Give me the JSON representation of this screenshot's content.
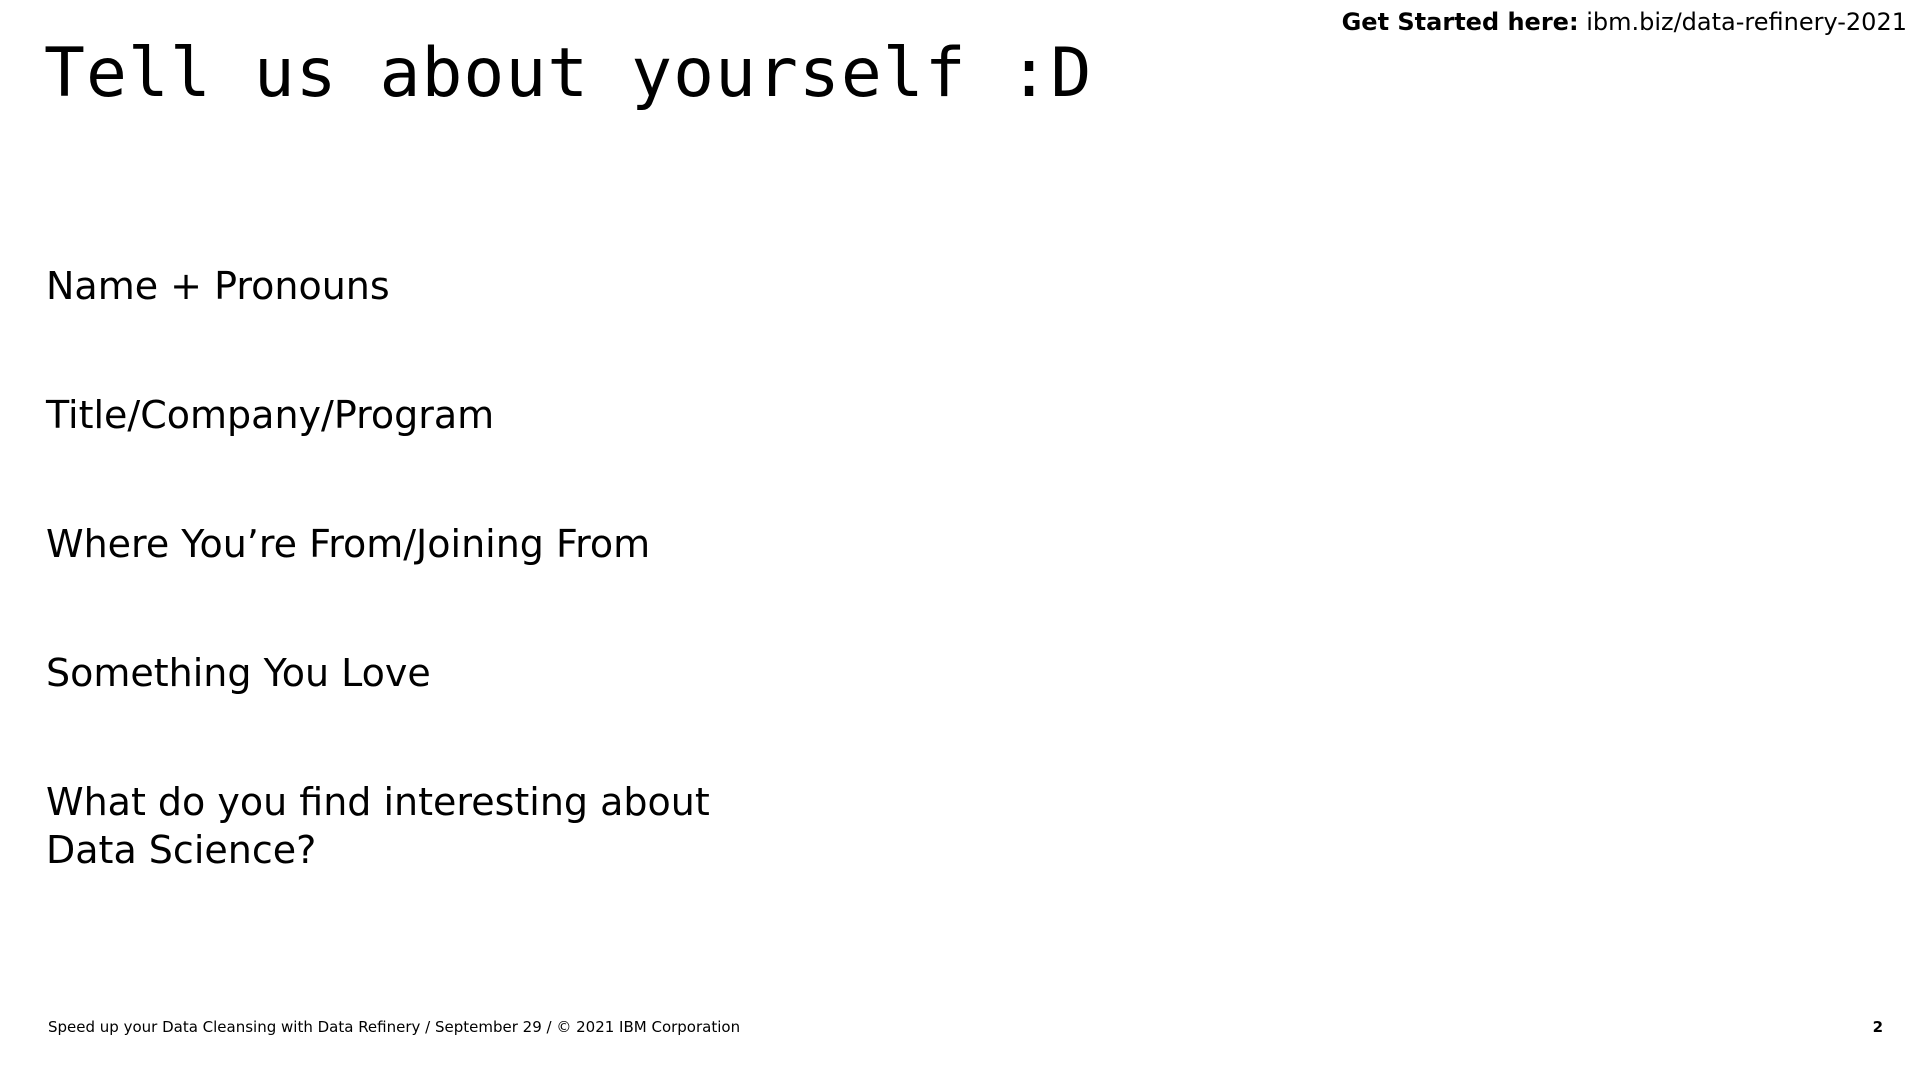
{
  "header": {
    "get_started_label": "Get Started here:",
    "get_started_url": "ibm.biz/data-refinery-2021"
  },
  "title": "Tell us about yourself :D",
  "prompts": [
    "Name + Pronouns",
    "Title/Company/Program",
    "Where You’re From/Joining From",
    "Something You Love",
    "What do you find interesting about Data Science?"
  ],
  "footer": {
    "text": "Speed up your Data Cleansing with Data Refinery / September 29 / © 2021 IBM Corporation",
    "page_number": "2"
  }
}
